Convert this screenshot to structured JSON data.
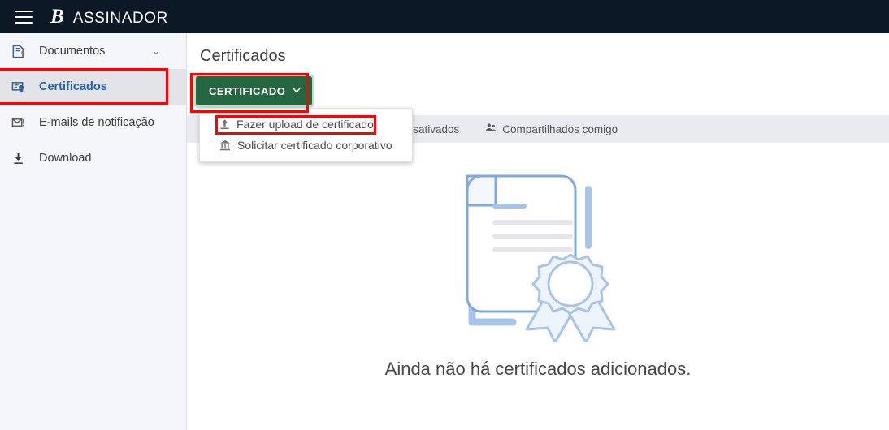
{
  "header": {
    "menu_icon": "hamburger-icon",
    "brand_mark": "B",
    "brand_name": "ASSINADOR",
    "background": "#0d1827"
  },
  "sidebar": {
    "background": "#f4f6f9",
    "active_background": "#e2e4e8",
    "active_text_color": "#2a5fa8",
    "items": [
      {
        "label": "Documentos",
        "icon": "document-pen-icon",
        "has_chevron": true,
        "chevron": "⌄",
        "active": false
      },
      {
        "label": "Certificados",
        "icon": "certificate-icon",
        "has_chevron": false,
        "chevron": "",
        "active": true
      },
      {
        "label": "E-mails de notificação",
        "icon": "mail-alert-icon",
        "has_chevron": false,
        "chevron": "",
        "active": false
      },
      {
        "label": "Download",
        "icon": "download-icon",
        "has_chevron": false,
        "chevron": "",
        "active": false
      }
    ]
  },
  "main": {
    "page_title": "Certificados",
    "primary_button": {
      "label": "CERTIFICADO",
      "caret": "⌄",
      "background": "#23663f",
      "focus_ring": "#bfe0c9"
    },
    "dropdown": {
      "items": [
        {
          "label": "Fazer upload de certificado",
          "icon": "upload-icon"
        },
        {
          "label": "Solicitar certificado corporativo",
          "icon": "bank-icon"
        }
      ]
    },
    "tabs": [
      {
        "label": "Desativados",
        "icon": "",
        "active": false
      },
      {
        "label": "Compartilhados comigo",
        "icon": "people-icon",
        "active": false
      }
    ],
    "tabstrip_background": "#eaebef",
    "empty_state": {
      "illustration": "certificate-scroll-with-seal",
      "message": "Ainda não há certificados adicionados.",
      "illustration_color": "#a8c4e8",
      "illustration_fill": "#eef4fb"
    }
  },
  "annotations": {
    "color": "#ff0000",
    "boxes": [
      {
        "name": "sidebar-item-certificados-highlight"
      },
      {
        "name": "certificado-button-highlight"
      },
      {
        "name": "fazer-upload-item-highlight"
      }
    ]
  }
}
